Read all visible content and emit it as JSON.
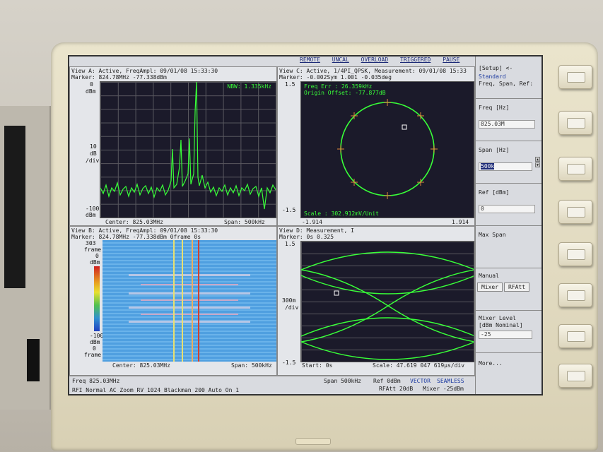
{
  "topbar": {
    "items": [
      "REMOTE",
      "UNCAL",
      "OVERLOAD",
      "TRIGGERED",
      "PAUSE"
    ]
  },
  "viewA": {
    "header": "View A: Active, FreqAmpl: 09/01/08 15:33:30",
    "marker": "Marker: 824.78MHz   -77.338dBm",
    "y_top": "0",
    "y_top_unit": "dBm",
    "y_mid": "10",
    "y_mid_unit1": "dB",
    "y_mid_unit2": "/div",
    "y_bottom": "-100",
    "y_bottom_unit": "dBm",
    "nbw": "NBW: 1.335kHz",
    "center": "Center: 825.03MHz",
    "span": "Span: 500kHz"
  },
  "viewC": {
    "header": "View C: Active, 1/4PI_QPSK, Measurement: 09/01/08 15:33",
    "marker": "Marker: -0.002Sym  1.001  -0.035deg",
    "freq_err": "Freq Err      : 26.359kHz",
    "origin": "Origin Offset: -77.877dB",
    "y_top": "1.5",
    "y_bottom": "-1.5",
    "scale": "Scale : 302.912mV/Unit",
    "x_left": "-1.914",
    "x_right": "1.914"
  },
  "viewB": {
    "header": "View B: Active, FreqAmpl: 09/01/08 15:33:30",
    "marker": "Marker: 824.78MHz  -77.338dBm   0frame  0s",
    "y_top": "303",
    "y_top_unit": "frame",
    "y_scale_top": "0",
    "y_scale_top_unit": "dBm",
    "y_scale_bottom": "-100",
    "y_scale_bottom_unit": "dBm",
    "y_bottom": "0",
    "y_bottom_unit": "frame",
    "center": "Center: 825.03MHz",
    "span": "Span: 500kHz"
  },
  "viewD": {
    "header": "View D: Measurement, I",
    "marker": "Marker: 0s  0.325",
    "y_top": "1.5",
    "y_mid": "300m",
    "y_mid_unit": "/div",
    "y_bottom": "-1.5",
    "start": "Start: 0s",
    "scale": "Scale: 47.619 047 619µs/div"
  },
  "statusbar": {
    "freq": "Freq 825.03MHz",
    "span": "Span 500kHz",
    "ref": "Ref 0dBm",
    "vector": "VECTOR",
    "seamless": "SEAMLESS",
    "rfatt": "RFAtt 20dB",
    "mixer": "Mixer -25dBm",
    "line2": "RFI Normal AC Zoom RV 1024 Blackman",
    "line2_hl": "1024",
    "line2_end": "200 Auto On 1"
  },
  "sidebar": {
    "setup_title": "[Setup] <-",
    "setup_mode": "Standard",
    "setup_sub": "Freq, Span, Ref:",
    "freq_label": "Freq [Hz]",
    "freq_value": "825.03M",
    "span_label": "Span [Hz]",
    "span_value": "500k",
    "ref_label": "Ref [dBm]",
    "ref_value": "0",
    "maxspan_label": "Max Span",
    "manual_label": "Manual",
    "mixer_btn": "Mixer",
    "rfatt_btn": "RFAtt",
    "mixer_level_label": "Mixer Level",
    "mixer_level_sub": "[dBm Nominal]",
    "mixer_level_value": "-25",
    "more_label": "More..."
  },
  "colors": {
    "trace": "#38ff38",
    "plot_bg": "#1b1a2a",
    "accent": "#1c2a77",
    "bezel": "#e1dac0"
  }
}
